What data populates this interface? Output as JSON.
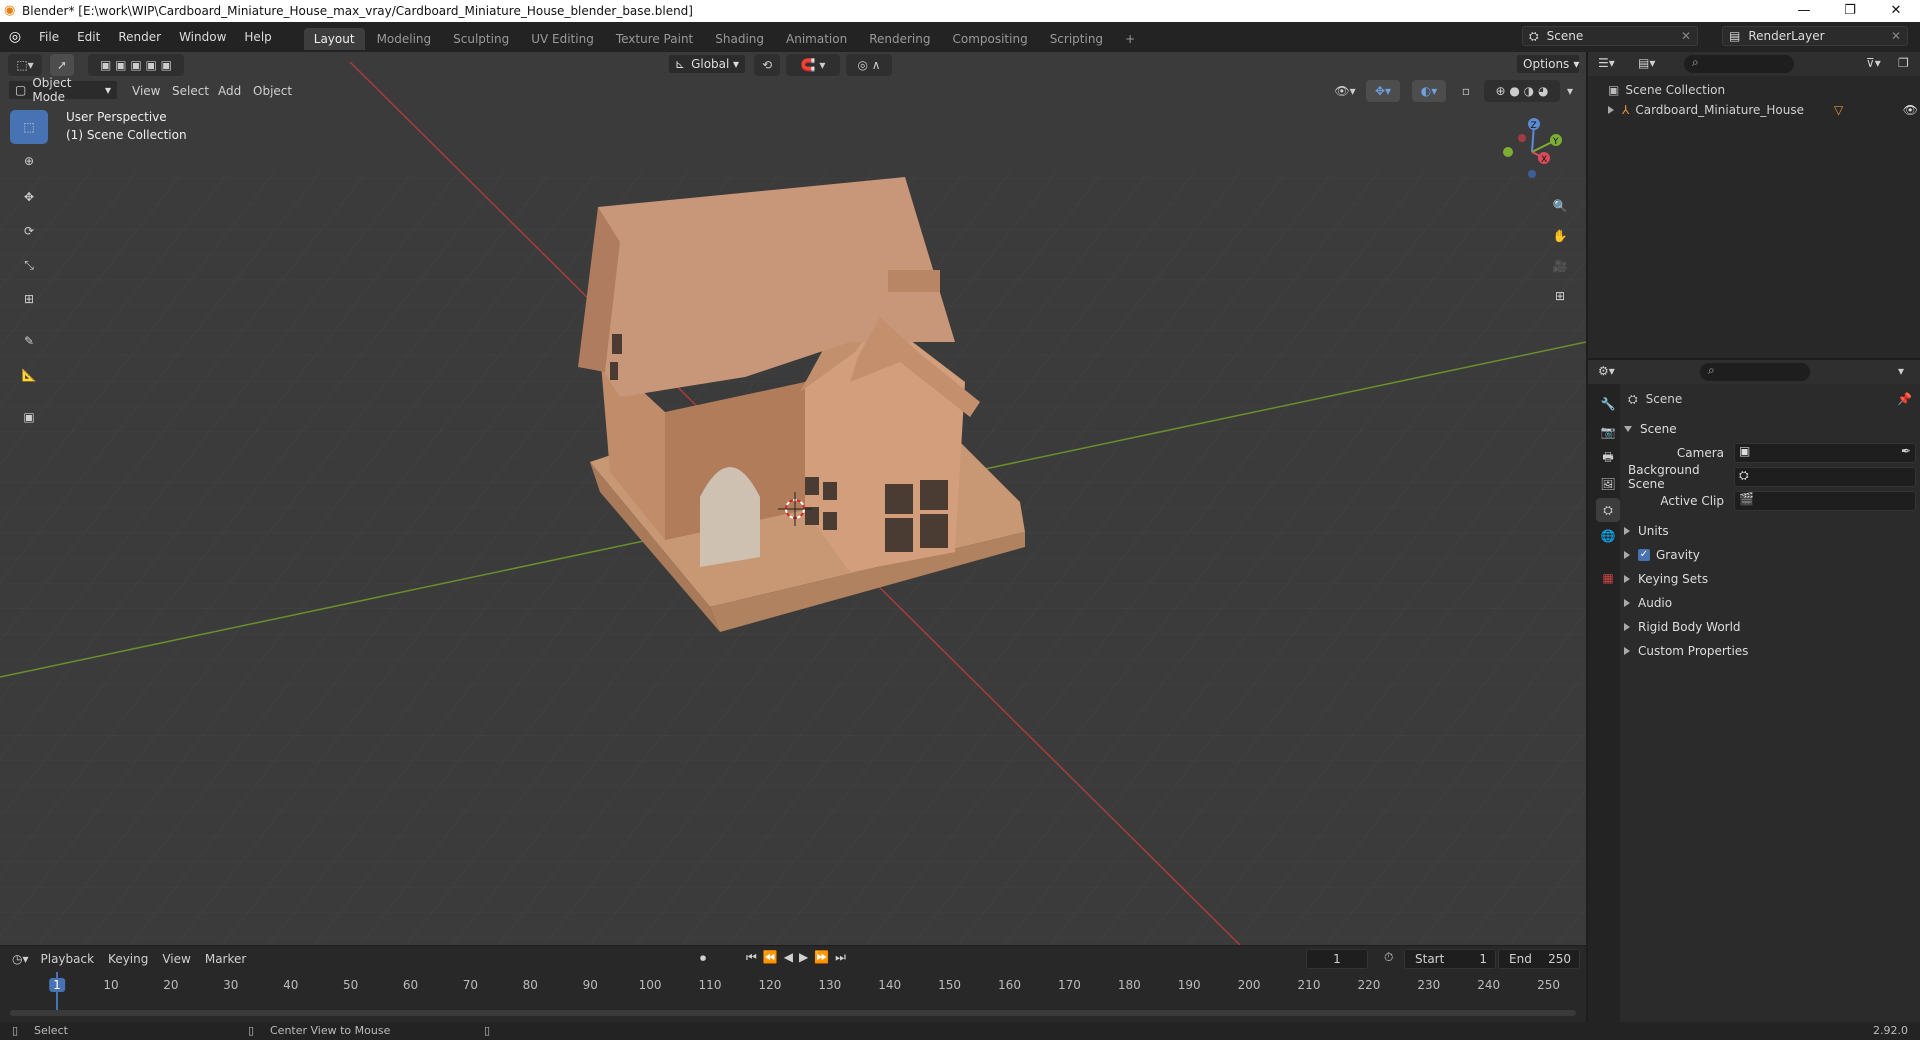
{
  "window": {
    "title": "Blender* [E:\\work\\WIP\\Cardboard_Miniature_House_max_vray/Cardboard_Miniature_House_blender_base.blend]",
    "minimize": "—",
    "restore": "❐",
    "close": "✕"
  },
  "menu": [
    "File",
    "Edit",
    "Render",
    "Window",
    "Help"
  ],
  "workspaces": [
    "Layout",
    "Modeling",
    "Sculpting",
    "UV Editing",
    "Texture Paint",
    "Shading",
    "Animation",
    "Rendering",
    "Compositing",
    "Scripting"
  ],
  "scene_selector": {
    "value": "Scene"
  },
  "renderlayer_selector": {
    "value": "RenderLayer"
  },
  "viewport": {
    "orientation": "Global",
    "options": "Options",
    "mode": "Object Mode",
    "header_menu": [
      "View",
      "Select",
      "Add",
      "Object"
    ],
    "perspective_label": "User Perspective",
    "collection_label": "(1) Scene Collection",
    "gizmo": {
      "x": "X",
      "y": "Y",
      "z": "Z"
    }
  },
  "outliner": {
    "root": "Scene Collection",
    "items": [
      {
        "label": "Cardboard_Miniature_House"
      }
    ]
  },
  "properties": {
    "header": "Scene",
    "section": "Scene",
    "fields": [
      {
        "label": "Camera"
      },
      {
        "label": "Background Scene"
      },
      {
        "label": "Active Clip"
      }
    ],
    "panels": [
      {
        "label": "Units",
        "checkbox": false
      },
      {
        "label": "Gravity",
        "checkbox": true
      },
      {
        "label": "Keying Sets",
        "checkbox": false
      },
      {
        "label": "Audio",
        "checkbox": false
      },
      {
        "label": "Rigid Body World",
        "checkbox": false
      },
      {
        "label": "Custom Properties",
        "checkbox": false
      }
    ]
  },
  "timeline": {
    "menu": [
      "Playback",
      "Keying",
      "View",
      "Marker"
    ],
    "current_frame": "1",
    "start_label": "Start",
    "start": "1",
    "end_label": "End",
    "end": "250",
    "ticks": [
      "1",
      "10",
      "20",
      "30",
      "40",
      "50",
      "60",
      "70",
      "80",
      "90",
      "100",
      "110",
      "120",
      "130",
      "140",
      "150",
      "160",
      "170",
      "180",
      "190",
      "200",
      "210",
      "220",
      "230",
      "240",
      "250"
    ]
  },
  "statusbar": {
    "left": "Select",
    "middle": "Center View to Mouse",
    "version": "2.92.0"
  }
}
